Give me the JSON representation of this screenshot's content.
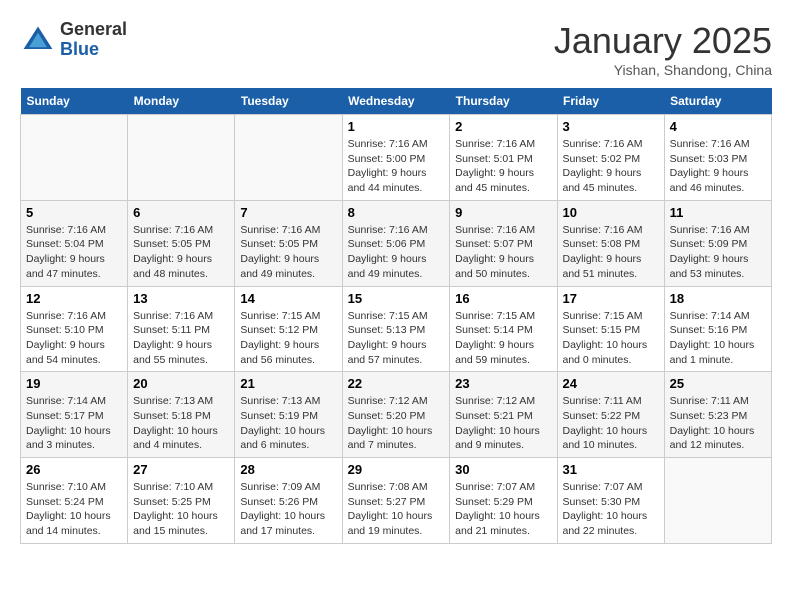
{
  "logo": {
    "general": "General",
    "blue": "Blue"
  },
  "title": "January 2025",
  "subtitle": "Yishan, Shandong, China",
  "days_of_week": [
    "Sunday",
    "Monday",
    "Tuesday",
    "Wednesday",
    "Thursday",
    "Friday",
    "Saturday"
  ],
  "weeks": [
    [
      {
        "day": "",
        "info": ""
      },
      {
        "day": "",
        "info": ""
      },
      {
        "day": "",
        "info": ""
      },
      {
        "day": "1",
        "info": "Sunrise: 7:16 AM\nSunset: 5:00 PM\nDaylight: 9 hours\nand 44 minutes."
      },
      {
        "day": "2",
        "info": "Sunrise: 7:16 AM\nSunset: 5:01 PM\nDaylight: 9 hours\nand 45 minutes."
      },
      {
        "day": "3",
        "info": "Sunrise: 7:16 AM\nSunset: 5:02 PM\nDaylight: 9 hours\nand 45 minutes."
      },
      {
        "day": "4",
        "info": "Sunrise: 7:16 AM\nSunset: 5:03 PM\nDaylight: 9 hours\nand 46 minutes."
      }
    ],
    [
      {
        "day": "5",
        "info": "Sunrise: 7:16 AM\nSunset: 5:04 PM\nDaylight: 9 hours\nand 47 minutes."
      },
      {
        "day": "6",
        "info": "Sunrise: 7:16 AM\nSunset: 5:05 PM\nDaylight: 9 hours\nand 48 minutes."
      },
      {
        "day": "7",
        "info": "Sunrise: 7:16 AM\nSunset: 5:05 PM\nDaylight: 9 hours\nand 49 minutes."
      },
      {
        "day": "8",
        "info": "Sunrise: 7:16 AM\nSunset: 5:06 PM\nDaylight: 9 hours\nand 49 minutes."
      },
      {
        "day": "9",
        "info": "Sunrise: 7:16 AM\nSunset: 5:07 PM\nDaylight: 9 hours\nand 50 minutes."
      },
      {
        "day": "10",
        "info": "Sunrise: 7:16 AM\nSunset: 5:08 PM\nDaylight: 9 hours\nand 51 minutes."
      },
      {
        "day": "11",
        "info": "Sunrise: 7:16 AM\nSunset: 5:09 PM\nDaylight: 9 hours\nand 53 minutes."
      }
    ],
    [
      {
        "day": "12",
        "info": "Sunrise: 7:16 AM\nSunset: 5:10 PM\nDaylight: 9 hours\nand 54 minutes."
      },
      {
        "day": "13",
        "info": "Sunrise: 7:16 AM\nSunset: 5:11 PM\nDaylight: 9 hours\nand 55 minutes."
      },
      {
        "day": "14",
        "info": "Sunrise: 7:15 AM\nSunset: 5:12 PM\nDaylight: 9 hours\nand 56 minutes."
      },
      {
        "day": "15",
        "info": "Sunrise: 7:15 AM\nSunset: 5:13 PM\nDaylight: 9 hours\nand 57 minutes."
      },
      {
        "day": "16",
        "info": "Sunrise: 7:15 AM\nSunset: 5:14 PM\nDaylight: 9 hours\nand 59 minutes."
      },
      {
        "day": "17",
        "info": "Sunrise: 7:15 AM\nSunset: 5:15 PM\nDaylight: 10 hours\nand 0 minutes."
      },
      {
        "day": "18",
        "info": "Sunrise: 7:14 AM\nSunset: 5:16 PM\nDaylight: 10 hours\nand 1 minute."
      }
    ],
    [
      {
        "day": "19",
        "info": "Sunrise: 7:14 AM\nSunset: 5:17 PM\nDaylight: 10 hours\nand 3 minutes."
      },
      {
        "day": "20",
        "info": "Sunrise: 7:13 AM\nSunset: 5:18 PM\nDaylight: 10 hours\nand 4 minutes."
      },
      {
        "day": "21",
        "info": "Sunrise: 7:13 AM\nSunset: 5:19 PM\nDaylight: 10 hours\nand 6 minutes."
      },
      {
        "day": "22",
        "info": "Sunrise: 7:12 AM\nSunset: 5:20 PM\nDaylight: 10 hours\nand 7 minutes."
      },
      {
        "day": "23",
        "info": "Sunrise: 7:12 AM\nSunset: 5:21 PM\nDaylight: 10 hours\nand 9 minutes."
      },
      {
        "day": "24",
        "info": "Sunrise: 7:11 AM\nSunset: 5:22 PM\nDaylight: 10 hours\nand 10 minutes."
      },
      {
        "day": "25",
        "info": "Sunrise: 7:11 AM\nSunset: 5:23 PM\nDaylight: 10 hours\nand 12 minutes."
      }
    ],
    [
      {
        "day": "26",
        "info": "Sunrise: 7:10 AM\nSunset: 5:24 PM\nDaylight: 10 hours\nand 14 minutes."
      },
      {
        "day": "27",
        "info": "Sunrise: 7:10 AM\nSunset: 5:25 PM\nDaylight: 10 hours\nand 15 minutes."
      },
      {
        "day": "28",
        "info": "Sunrise: 7:09 AM\nSunset: 5:26 PM\nDaylight: 10 hours\nand 17 minutes."
      },
      {
        "day": "29",
        "info": "Sunrise: 7:08 AM\nSunset: 5:27 PM\nDaylight: 10 hours\nand 19 minutes."
      },
      {
        "day": "30",
        "info": "Sunrise: 7:07 AM\nSunset: 5:29 PM\nDaylight: 10 hours\nand 21 minutes."
      },
      {
        "day": "31",
        "info": "Sunrise: 7:07 AM\nSunset: 5:30 PM\nDaylight: 10 hours\nand 22 minutes."
      },
      {
        "day": "",
        "info": ""
      }
    ]
  ]
}
